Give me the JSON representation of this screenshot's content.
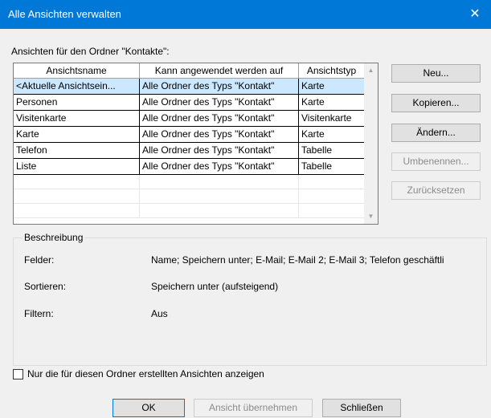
{
  "window": {
    "title": "Alle Ansichten verwalten"
  },
  "list": {
    "label": "Ansichten für den Ordner \"Kontakte\":",
    "columns": [
      "Ansichtsname",
      "Kann angewendet werden auf",
      "Ansichtstyp"
    ],
    "rows": [
      [
        "<Aktuelle Ansichtsein...",
        "Alle Ordner des Typs \"Kontakt\"",
        "Karte"
      ],
      [
        "Personen",
        "Alle Ordner des Typs \"Kontakt\"",
        "Karte"
      ],
      [
        "Visitenkarte",
        "Alle Ordner des Typs \"Kontakt\"",
        "Visitenkarte"
      ],
      [
        "Karte",
        "Alle Ordner des Typs \"Kontakt\"",
        "Karte"
      ],
      [
        "Telefon",
        "Alle Ordner des Typs \"Kontakt\"",
        "Tabelle"
      ],
      [
        "Liste",
        "Alle Ordner des Typs \"Kontakt\"",
        "Tabelle"
      ]
    ],
    "selected_row": 0
  },
  "buttons": {
    "new": "Neu...",
    "copy": "Kopieren...",
    "modify": "Ändern...",
    "rename": "Umbenennen...",
    "reset": "Zurücksetzen"
  },
  "description": {
    "title": "Beschreibung",
    "fields_label": "Felder:",
    "fields_value": "Name; Speichern unter; E-Mail; E-Mail 2; E-Mail 3; Telefon geschäftli",
    "sort_label": "Sortieren:",
    "sort_value": "Speichern unter (aufsteigend)",
    "filter_label": "Filtern:",
    "filter_value": "Aus"
  },
  "checkbox": {
    "label": "Nur die für diesen Ordner erstellten Ansichten anzeigen",
    "checked": false
  },
  "footer": {
    "ok": "OK",
    "apply": "Ansicht übernehmen",
    "close": "Schließen"
  },
  "icons": {
    "close": "close-icon",
    "scroll_up": "scroll-up-arrow-icon",
    "scroll_down": "scroll-down-arrow-icon"
  },
  "colors": {
    "titlebar": "#0078d7",
    "selection": "#cce8ff",
    "dialog_bg": "#f0f0f0"
  }
}
